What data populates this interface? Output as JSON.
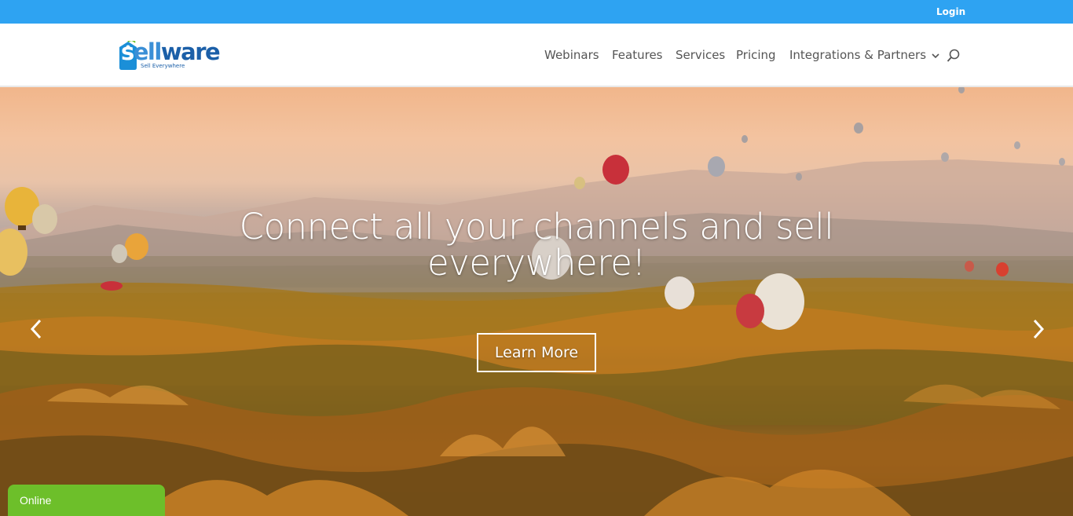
{
  "topbar": {
    "login_label": "Login",
    "bg_color": "#2ea3f2"
  },
  "logo": {
    "word_s": "s",
    "word_ell": "ell",
    "word_ware": "ware",
    "tagline": "Sell Everywhere"
  },
  "nav": {
    "items": [
      {
        "label": "Webinars"
      },
      {
        "label": "Features"
      },
      {
        "label": "Services"
      },
      {
        "label": "Pricing"
      },
      {
        "label": "Integrations & Partners",
        "has_dropdown": true
      }
    ],
    "search_icon": "search-icon"
  },
  "hero": {
    "title": "Connect all your channels and sell everywhere!",
    "button_label": "Learn More",
    "prev_icon": "chevron-left-icon",
    "next_icon": "chevron-right-icon"
  },
  "chat": {
    "status_label": "Online",
    "color": "#6dbf2a"
  }
}
